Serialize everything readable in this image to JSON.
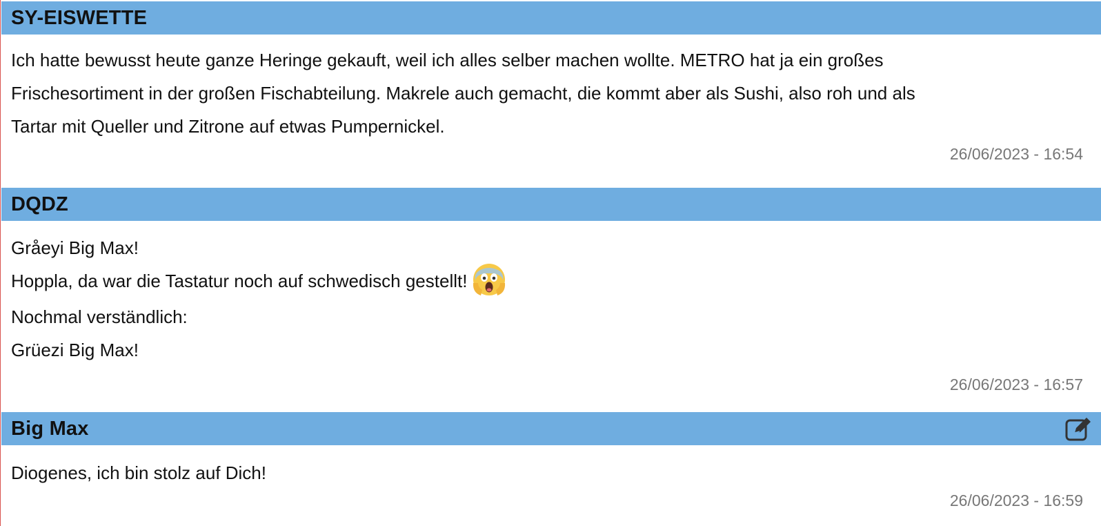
{
  "posts": [
    {
      "author": "SY-EISWETTE",
      "lines": [
        "Ich hatte bewusst heute ganze Heringe gekauft, weil ich alles selber machen wollte. METRO hat ja ein großes",
        "Frischesortiment in der großen Fischabteilung. Makrele auch gemacht, die kommt aber als Sushi, also roh und als",
        "Tartar mit Queller und Zitrone auf etwas Pumpernickel."
      ],
      "timestamp": "26/06/2023 - 16:54"
    },
    {
      "author": "DQDZ",
      "lines": [
        "Gråeyi Big Max!",
        "Hoppla, da war die Tastatur noch auf schwedisch gestellt!",
        "Nochmal verständlich:",
        "Grüezi Big Max!"
      ],
      "emoji": "face-screaming-in-fear-icon",
      "timestamp": "26/06/2023 - 16:57"
    },
    {
      "author": "Big Max",
      "lines": [
        "Diogenes, ich bin stolz auf Dich!"
      ],
      "edit_icon": "edit-icon",
      "timestamp": "26/06/2023 - 16:59"
    }
  ],
  "colors": {
    "header_bg": "#6fade0",
    "text": "#111111",
    "timestamp": "#777777",
    "left_border": "#d9534f"
  }
}
